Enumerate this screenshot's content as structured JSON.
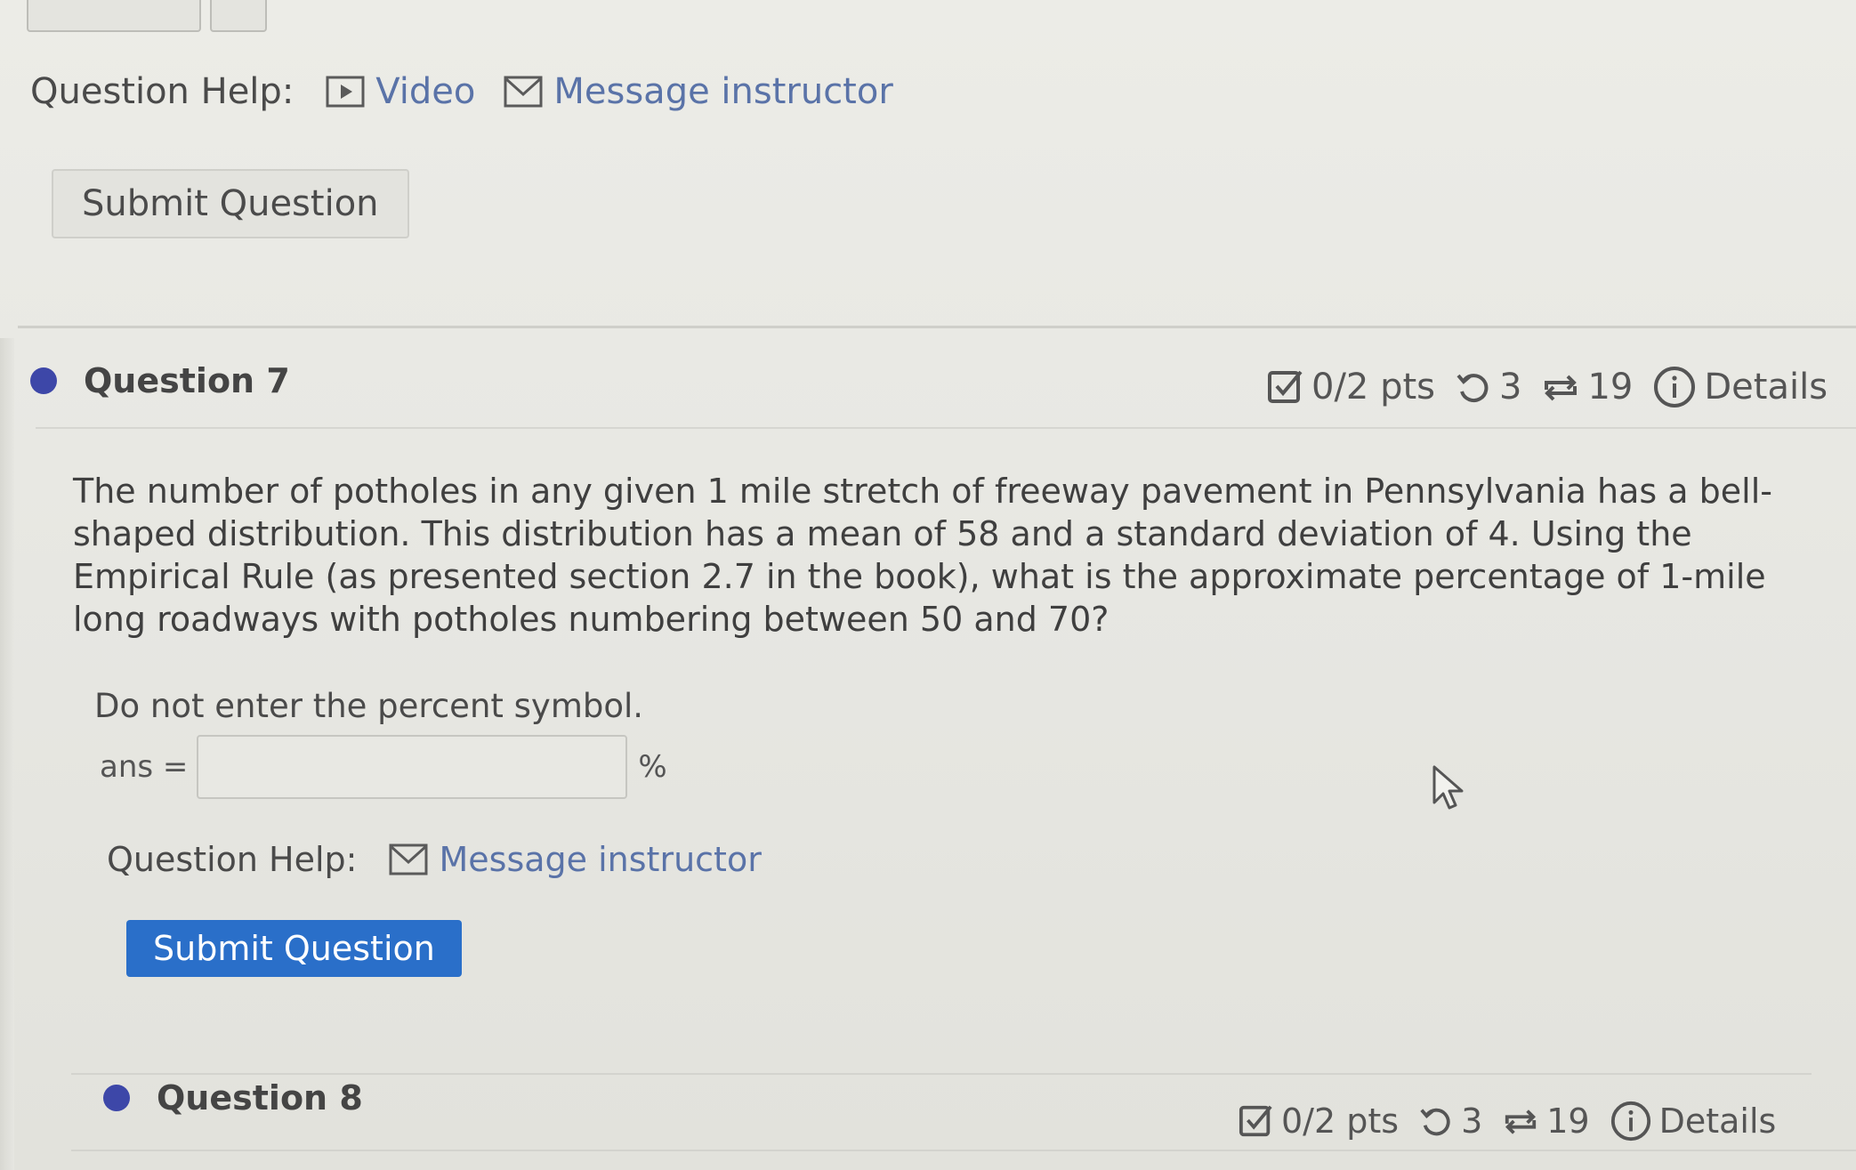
{
  "top_help": {
    "label": "Question Help:",
    "video": "Video",
    "message": "Message instructor"
  },
  "top_submit": "Submit Question",
  "question7": {
    "title": "Question 7",
    "pts": "0/2 pts",
    "retries": "3",
    "attempts": "19",
    "details": "Details",
    "text": "The number of potholes in any given 1 mile stretch of freeway pavement in Pennsylvania has a bell-shaped distribution. This distribution has a mean of 58 and a standard deviation of 4. Using the Empirical Rule (as presented section 2.7 in the book), what is the approximate percentage of 1-mile long roadways with potholes numbering between 50 and 70?",
    "instruction": "Do not enter the percent symbol.",
    "ans_label": "ans =",
    "ans_value": "",
    "unit": "%",
    "help_label": "Question Help:",
    "help_message": "Message instructor",
    "submit": "Submit Question"
  },
  "question8": {
    "title": "Question 8",
    "pts": "0/2 pts",
    "retries": "3",
    "attempts": "19",
    "details": "Details"
  },
  "colors": {
    "link": "#5a73a8",
    "primary_button": "#2a6fc9",
    "dot": "#3d47a8",
    "background": "#e9e9e4"
  },
  "icons": {
    "video": "video-icon",
    "message": "envelope-icon",
    "score": "checkbox-icon",
    "retry": "retry-icon",
    "attempts": "shuffle-icon",
    "details": "info-icon",
    "cursor": "mouse-cursor-icon"
  }
}
